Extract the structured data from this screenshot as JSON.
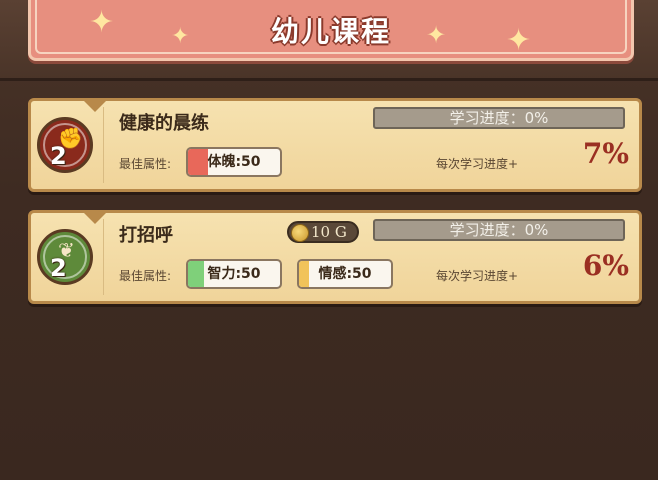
{
  "header": {
    "title": "幼儿课程"
  },
  "courses": [
    {
      "level": "2",
      "title": "健康的晨练",
      "progress_text": "学习进度：0%",
      "progress": 0,
      "best_attr_label": "最佳属性:",
      "attrs": [
        {
          "label": "体魄:50",
          "color": "#e8685a"
        }
      ],
      "per_label": "每次学习进度+",
      "per_value": "7%",
      "badge_color": "#8a2a1c"
    },
    {
      "level": "2",
      "title": "打招呼",
      "cost": "10 G",
      "progress_text": "学习进度：0%",
      "progress": 0,
      "best_attr_label": "最佳属性:",
      "attrs": [
        {
          "label": "智力:50",
          "color": "#7fd07a"
        },
        {
          "label": "情感:50",
          "color": "#f1c35a"
        }
      ],
      "per_label": "每次学习进度+",
      "per_value": "6%",
      "badge_color": "#5e8a3a"
    }
  ]
}
